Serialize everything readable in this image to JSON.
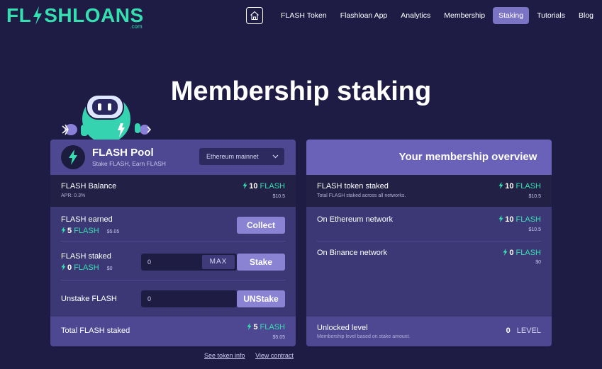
{
  "logo": {
    "text": "FLASHLOANS",
    "sub": ".com"
  },
  "nav": {
    "items": [
      {
        "label": "FLASH Token",
        "active": false
      },
      {
        "label": "Flashloan App",
        "active": false
      },
      {
        "label": "Analytics",
        "active": false
      },
      {
        "label": "Membership",
        "active": false
      },
      {
        "label": "Staking",
        "active": true
      },
      {
        "label": "Tutorials",
        "active": false
      },
      {
        "label": "Blog",
        "active": false
      }
    ]
  },
  "page_title": "Membership staking",
  "pool": {
    "name": "FLASH Pool",
    "subtitle": "Stake FLASH, Earn FLASH",
    "network": "Ethereum mainnet",
    "balance": {
      "label": "FLASH Balance",
      "apr": "APR: 0.3%",
      "amount": "10",
      "token": "FLASH",
      "usd": "$10.5"
    },
    "earned": {
      "label": "FLASH earned",
      "amount": "5",
      "token": "FLASH",
      "usd": "$5.05",
      "button": "Collect"
    },
    "staked": {
      "label": "FLASH staked",
      "amount": "0",
      "token": "FLASH",
      "usd": "$0",
      "input_value": "0",
      "max": "MAX",
      "button": "Stake"
    },
    "unstake": {
      "label": "Unstake FLASH",
      "input_value": "0",
      "button": "UNStake"
    },
    "total": {
      "label": "Total FLASH staked",
      "amount": "5",
      "token": "FLASH",
      "usd": "$5.05"
    }
  },
  "overview": {
    "title": "Your membership overview",
    "token_staked": {
      "label": "FLASH token staked",
      "sub": "Total FLASH staked across all networks.",
      "amount": "10",
      "token": "FLASH",
      "usd": "$10.5"
    },
    "ethereum": {
      "label": "On Ethereum network",
      "amount": "10",
      "token": "FLASH",
      "usd": "$10.5"
    },
    "binance": {
      "label": "On Binance network",
      "amount": "0",
      "token": "FLASH",
      "usd": "$0"
    },
    "level": {
      "label": "Unlocked level",
      "sub": "Membership level based on stake amount.",
      "value": "0",
      "unit": "LEVEL"
    }
  },
  "links": {
    "token_info": "See token info",
    "contract": "View contract"
  },
  "colors": {
    "background": "#1e1b45",
    "accent": "#35e0b0",
    "button": "#8a83d4",
    "active_nav": "#7b73c4"
  }
}
